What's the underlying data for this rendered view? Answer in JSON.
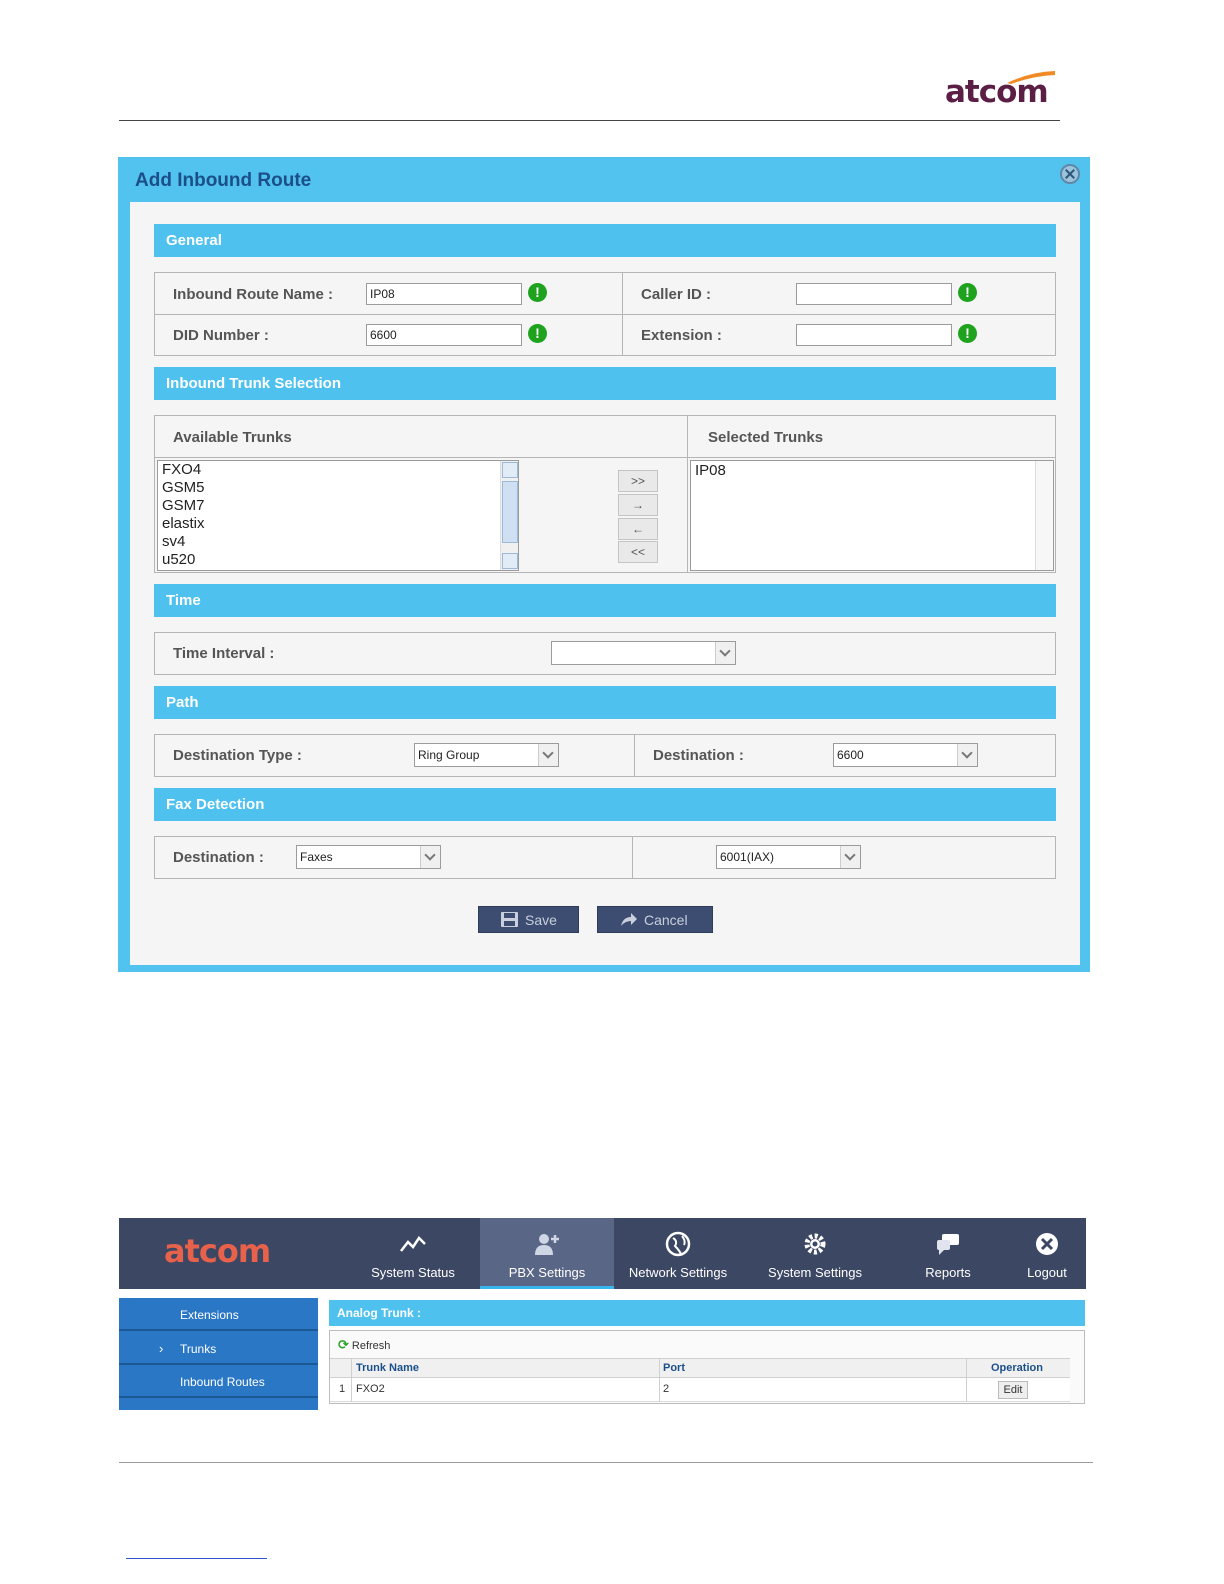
{
  "doc": {
    "brand": "atcom",
    "brand_color": "#5b1f45"
  },
  "dialog": {
    "title": "Add Inbound Route",
    "accent": "#52c2ee",
    "general": {
      "heading": "General",
      "route_name_label": "Inbound Route Name :",
      "route_name_value": "IP08",
      "caller_id_label": "Caller ID :",
      "caller_id_value": "",
      "did_label": "DID Number :",
      "did_value": "6600",
      "extension_label": "Extension :",
      "extension_value": ""
    },
    "trunks": {
      "heading": "Inbound Trunk Selection",
      "available_label": "Available Trunks",
      "selected_label": "Selected Trunks",
      "available": [
        "FXO4",
        "GSM5",
        "GSM7",
        "elastix",
        "sv4",
        "u520"
      ],
      "selected": [
        "IP08"
      ],
      "btn_add_all": ">>",
      "btn_add": "→",
      "btn_remove": "←",
      "btn_remove_all": "<<"
    },
    "time": {
      "heading": "Time",
      "interval_label": "Time Interval :",
      "interval_value": ""
    },
    "path": {
      "heading": "Path",
      "dest_type_label": "Destination Type :",
      "dest_type_value": "Ring Group",
      "dest_label": "Destination :",
      "dest_value": "6600"
    },
    "fax": {
      "heading": "Fax Detection",
      "dest_label": "Destination :",
      "dest_type_value": "Faxes",
      "dest_value": "6001(IAX)"
    },
    "save_label": "Save",
    "cancel_label": "Cancel"
  },
  "pbx": {
    "logo": "atcom",
    "nav": [
      {
        "label": "System Status",
        "icon": "chart-line-icon"
      },
      {
        "label": "PBX Settings",
        "icon": "add-user-icon"
      },
      {
        "label": "Network Settings",
        "icon": "globe-icon"
      },
      {
        "label": "System Settings",
        "icon": "gear-icon"
      },
      {
        "label": "Reports",
        "icon": "chat-icon"
      },
      {
        "label": "Logout",
        "icon": "close-circle-icon"
      }
    ],
    "active_nav": "PBX Settings",
    "sidebar": [
      {
        "label": "Extensions"
      },
      {
        "label": "Trunks"
      },
      {
        "label": "Inbound Routes"
      }
    ],
    "content_heading": "Analog Trunk :",
    "refresh_label": "Refresh",
    "columns": [
      "Trunk Name",
      "Port",
      "Operation"
    ],
    "rows": [
      {
        "index": "1",
        "trunk_name": "FXO2",
        "port": "2",
        "action": "Edit"
      }
    ]
  }
}
